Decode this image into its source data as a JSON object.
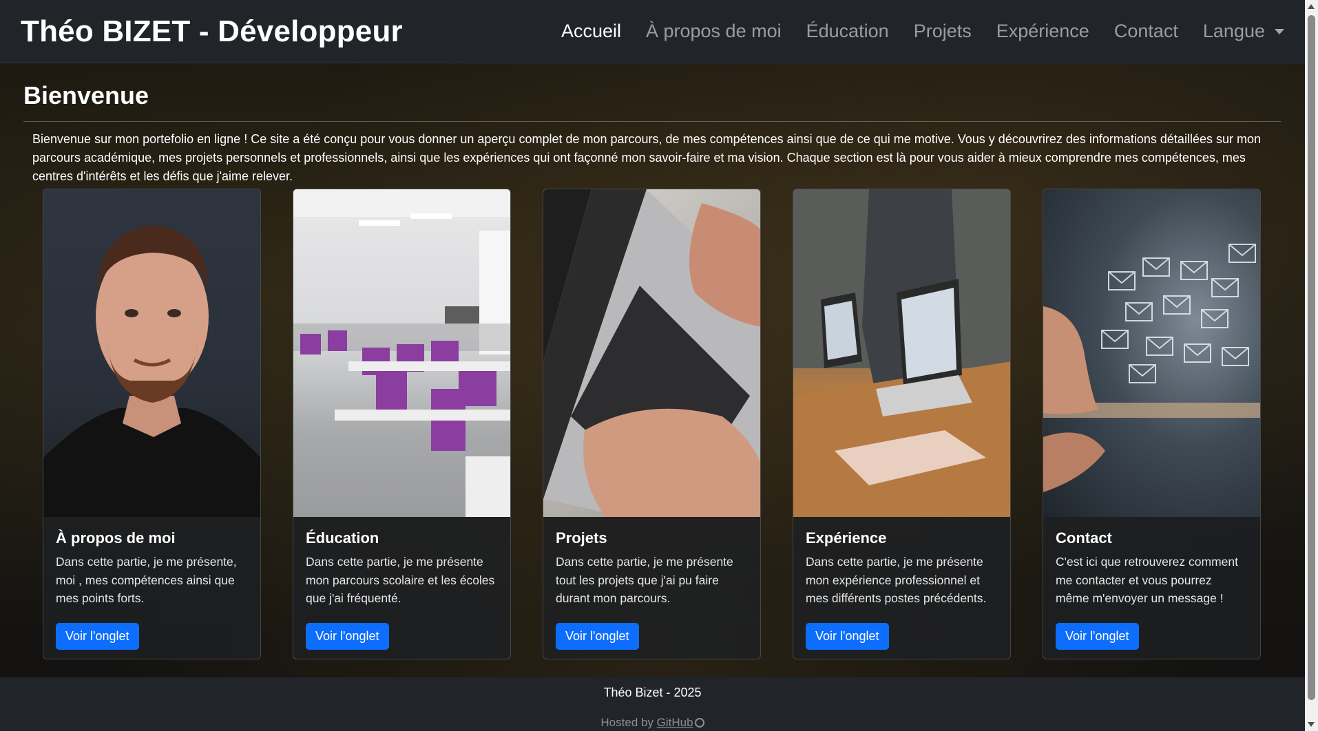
{
  "navbar": {
    "brand": "Théo BIZET - Développeur",
    "items": [
      {
        "label": "Accueil",
        "active": true
      },
      {
        "label": "À propos de moi",
        "active": false
      },
      {
        "label": "Éducation",
        "active": false
      },
      {
        "label": "Projets",
        "active": false
      },
      {
        "label": "Expérience",
        "active": false
      },
      {
        "label": "Contact",
        "active": false
      }
    ],
    "language_label": "Langue"
  },
  "main": {
    "title": "Bienvenue",
    "intro": "Bienvenue sur mon portefolio en ligne ! Ce site a été conçu pour vous donner un aperçu complet de mon parcours, de mes compétences ainsi que de ce qui me motive. Vous y découvrirez des informations détaillées sur mon parcours académique, mes projets personnels et professionnels, ainsi que les expériences qui ont façonné mon savoir-faire et ma vision. Chaque section est là pour vous aider à mieux comprendre mes compétences, mes centres d'intérêts et les défis que j'aime relever."
  },
  "cards": [
    {
      "title": "À propos de moi",
      "text": "Dans cette partie, je me présente, moi , mes compétences ainsi que mes points forts.",
      "button": "Voir l'onglet",
      "image": "portrait-photo"
    },
    {
      "title": "Éducation",
      "text": "Dans cette partie, je me présente mon parcours scolaire et les écoles que j'ai fréquenté.",
      "button": "Voir l'onglet",
      "image": "classroom-photo"
    },
    {
      "title": "Projets",
      "text": "Dans cette partie, je me présente tout les projets que j'ai pu faire durant mon parcours.",
      "button": "Voir l'onglet",
      "image": "laptop-typing-photo"
    },
    {
      "title": "Expérience",
      "text": "Dans cette partie, je me présente mon expérience professionnel et mes différents postes précédents.",
      "button": "Voir l'onglet",
      "image": "office-presentation-photo"
    },
    {
      "title": "Contact",
      "text": "C'est ici que retrouverez comment me contacter et vous pourrez même m'envoyer un message !",
      "button": "Voir l'onglet",
      "image": "email-envelopes-photo"
    }
  ],
  "footer": {
    "copyright": "Théo Bizet - 2025",
    "hosted_prefix": "Hosted by ",
    "hosted_link": "GitHub",
    "icon": "github-icon"
  },
  "colors": {
    "navbar_bg": "#212529",
    "primary_button": "#0d6efd"
  }
}
